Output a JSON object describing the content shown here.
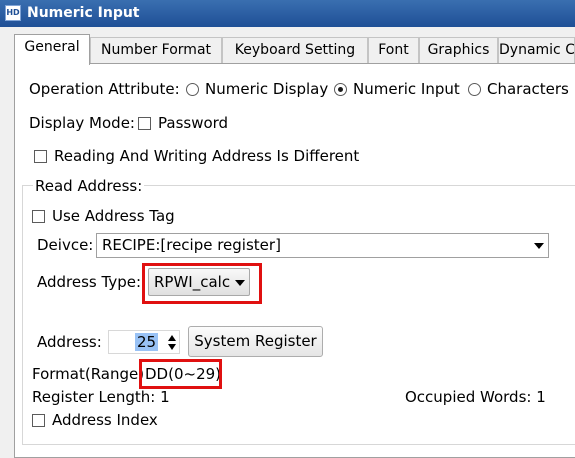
{
  "window": {
    "title": "Numeric Input",
    "icon": "app-icon"
  },
  "tabs": [
    {
      "label": "General",
      "active": true
    },
    {
      "label": "Number Format"
    },
    {
      "label": "Keyboard Setting"
    },
    {
      "label": "Font"
    },
    {
      "label": "Graphics"
    },
    {
      "label": "Dynamic C"
    }
  ],
  "general": {
    "operation_attribute": {
      "label": "Operation Attribute:",
      "options": [
        "Numeric Display",
        "Numeric Input",
        "Characters D"
      ],
      "selected": "Numeric Input"
    },
    "display_mode": {
      "label": "Display Mode:",
      "password_label": "Password",
      "password_checked": false
    },
    "rw_diff": {
      "label": "Reading And Writing Address Is Different",
      "checked": false
    },
    "read_address": {
      "group_label": "Read Address:",
      "use_tag": {
        "label": "Use Address Tag",
        "checked": false
      },
      "device": {
        "label": "Deivce:",
        "value": "RECIPE:[recipe register]"
      },
      "address_type": {
        "label": "Address Type:",
        "value": "RPWI_calc"
      },
      "address": {
        "label": "Address:",
        "value": "25",
        "button_label": "System Register"
      },
      "format": {
        "label": "Format(Range)",
        "value": "DD(0~29)"
      },
      "register_length": "Register Length: 1",
      "occupied_words": "Occupied Words: 1",
      "address_index": {
        "label": "Address Index",
        "checked": false
      }
    }
  },
  "colors": {
    "titlebar": "#2a5ca4",
    "highlight": "#e01010",
    "selection": "#99c2f5"
  }
}
